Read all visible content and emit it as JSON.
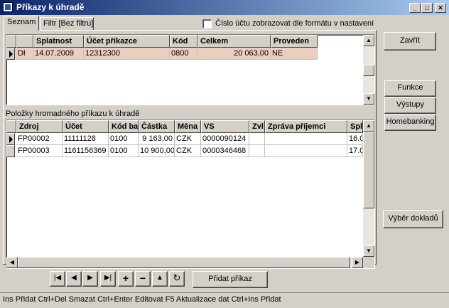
{
  "window": {
    "title": "Příkazy k úhradě"
  },
  "tabs": [
    {
      "label": "Seznam"
    },
    {
      "label": "Filtr [Bez filtru]"
    }
  ],
  "account_format_checkbox": {
    "label": "Číslo účtu zobrazovat dle formátu v nastavení",
    "checked": false
  },
  "orders_grid": {
    "columns": [
      "",
      "Splatnost",
      "Účet příkazce",
      "Kód",
      "Celkem",
      "Proveden"
    ],
    "rows": [
      {
        "type": "Dł",
        "due": "14.07.2009",
        "account": "12312300",
        "code": "0800",
        "total": "20 063,00",
        "done": "NE"
      }
    ]
  },
  "items_section": {
    "label": "Položky hromadného příkazu k úhradě"
  },
  "items_grid": {
    "columns": [
      "Zdroj",
      "Účet",
      "Kód ba",
      "Částka",
      "Měna",
      "VS",
      "Zvl",
      "Zpráva příjemci",
      "Spl"
    ],
    "rows": [
      {
        "source": "FP00002",
        "account": "11111128",
        "bank": "0100",
        "amount": "9 163,00",
        "currency": "CZK",
        "vs": "0000090124",
        "special": "",
        "message": "",
        "due": "16.0"
      },
      {
        "source": "FP00003",
        "account": "1161156369",
        "bank": "0100",
        "amount": "10 900,00",
        "currency": "CZK",
        "vs": "0000346468",
        "special": "",
        "message": "",
        "due": "17.0"
      }
    ]
  },
  "nav": {
    "first_glyph": "|◀",
    "prev_glyph": "◀",
    "next_glyph": "▶",
    "last_glyph": "▶|",
    "add_glyph": "+",
    "delete_glyph": "−",
    "up_glyph": "▲",
    "refresh_glyph": "↻",
    "add_order_label": "Přidat příkaz"
  },
  "side_buttons": {
    "close": "Zavřít",
    "functions": "Funkce",
    "outputs": "Výstupy",
    "homebanking": "Homebanking",
    "select_documents": "Výběr dokladů"
  },
  "status_bar": {
    "text": "Ins Přidat   Ctrl+Del Smazat   Ctrl+Enter Editovat   F5 Aktualizace dat   Ctrl+Ins Přidat"
  }
}
